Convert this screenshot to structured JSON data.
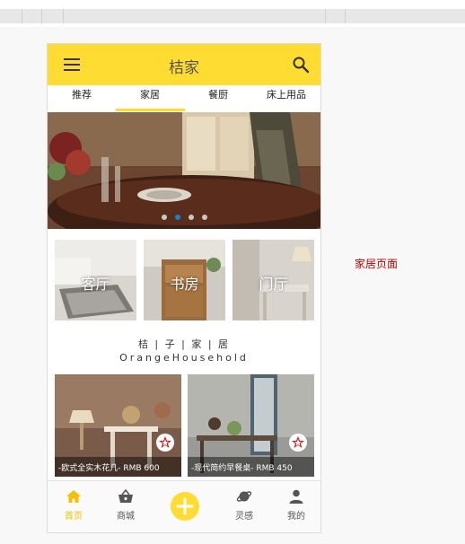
{
  "app": {
    "title": "桔家",
    "tabs": [
      "推荐",
      "家居",
      "餐厨",
      "床上用品"
    ],
    "active_tab": "家居",
    "banner_page_count": 4,
    "banner_active_index": 1,
    "categories": [
      "客厅",
      "书房",
      "门厅"
    ],
    "brand_cn": "桔 | 子 | 家 | 居",
    "brand_en": "OrangeHousehold",
    "products": [
      {
        "caption": "-欧式全实木花几- RMB 600"
      },
      {
        "caption": "-现代简约早餐桌- RMB 450"
      }
    ],
    "bottom_nav": [
      {
        "label": "首页",
        "icon": "home-icon",
        "active": true
      },
      {
        "label": "商城",
        "icon": "basket-icon",
        "active": false
      },
      {
        "label": "",
        "icon": "add-icon",
        "active": false
      },
      {
        "label": "灵感",
        "icon": "planet-icon",
        "active": false
      },
      {
        "label": "我的",
        "icon": "user-icon",
        "active": false
      }
    ]
  },
  "annotation": "家居页面",
  "colors": {
    "accent": "#fedc32",
    "active_text": "#f4c000",
    "annotation": "#c00000",
    "dot_active": "#1a7fd8"
  }
}
